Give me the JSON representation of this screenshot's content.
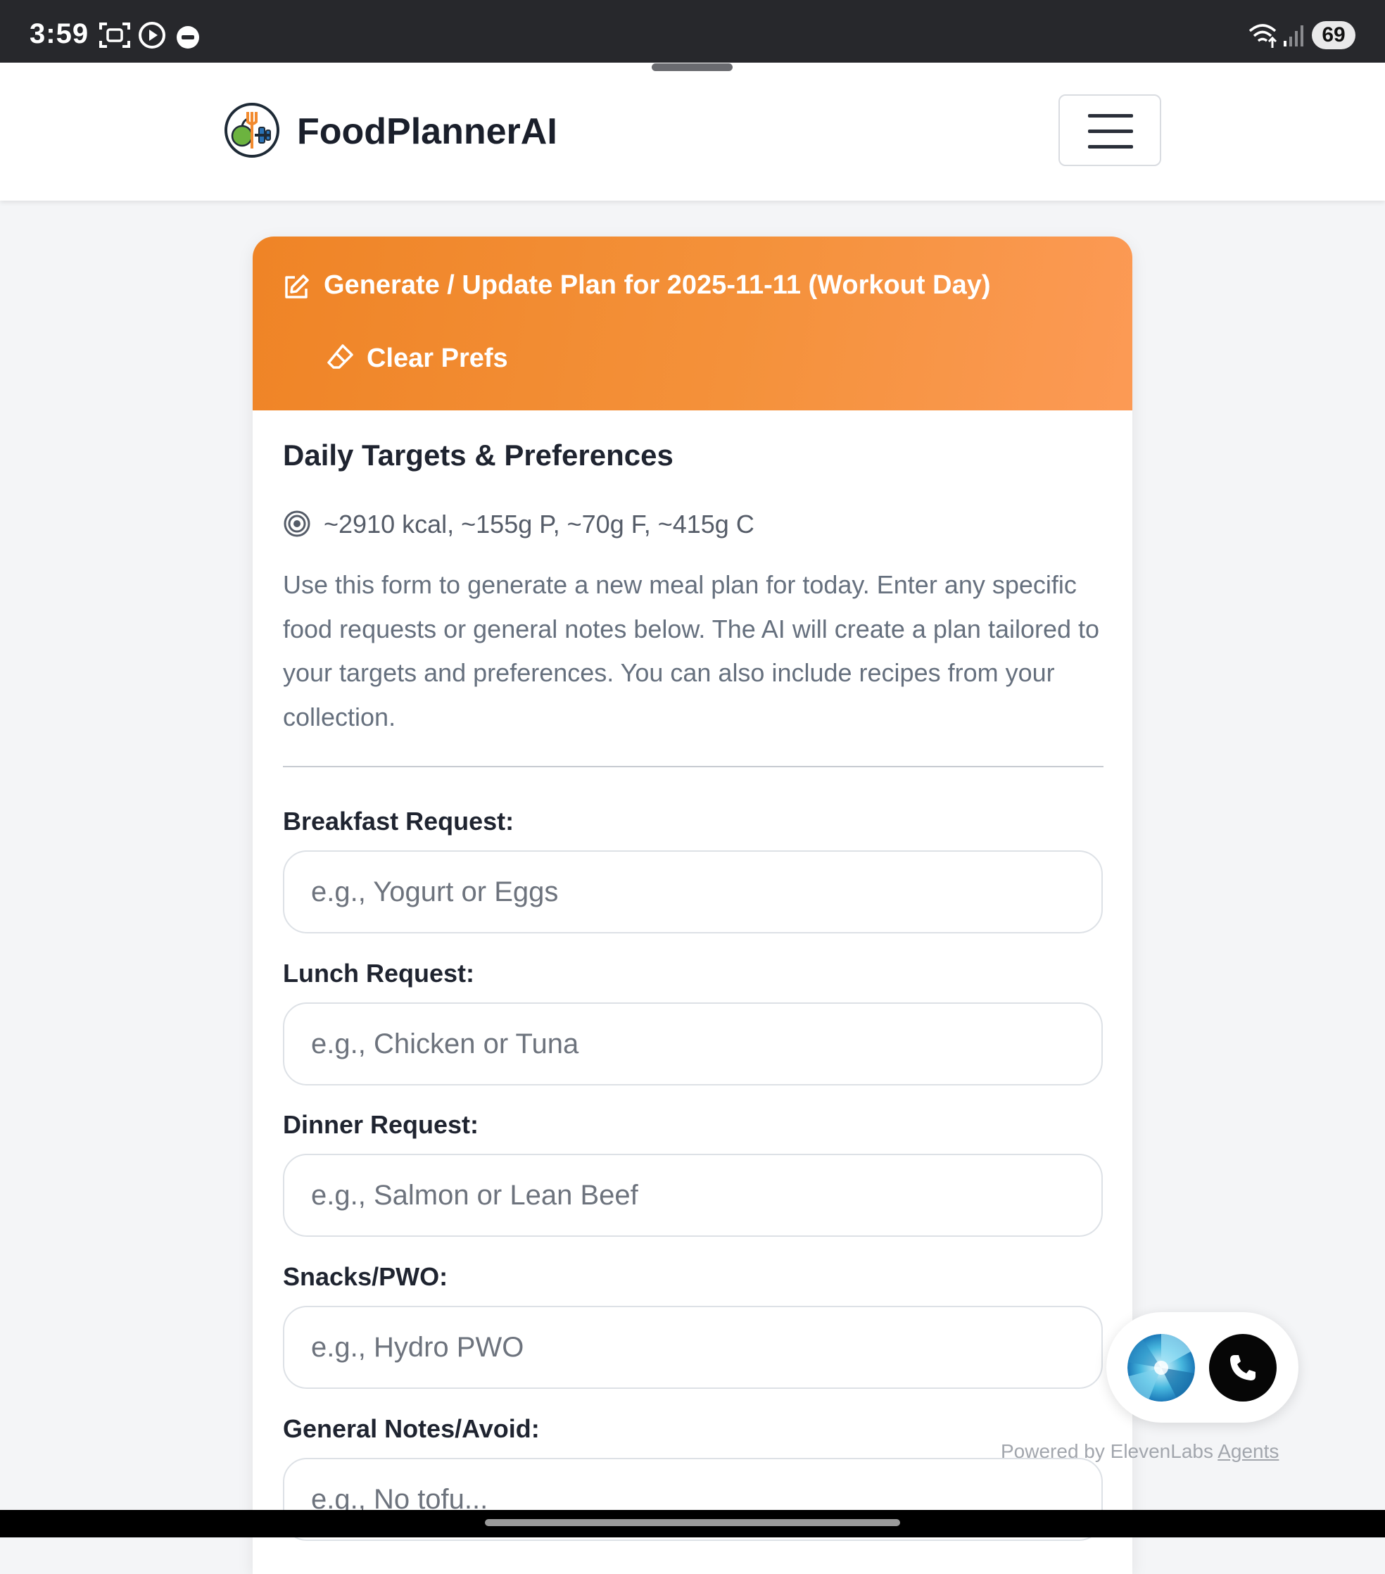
{
  "status_bar": {
    "time": "3:59",
    "battery": "69",
    "icons": [
      "screenshot-icon",
      "media-play-icon",
      "wear-icon",
      "wifi-icon",
      "signal-icon"
    ]
  },
  "header": {
    "brand": "FoodPlannerAI",
    "logo_icon": "apple-fork-dumbbell-logo",
    "menu_icon": "hamburger-icon"
  },
  "card": {
    "title": "Generate / Update Plan for 2025-11-11 (Workout Day)",
    "clear_label": "Clear Prefs",
    "section_title": "Daily Targets & Preferences",
    "targets": "~2910 kcal, ~155g P, ~70g F, ~415g C",
    "description": "Use this form to generate a new meal plan for today. Enter any specific food requests or general notes below. The AI will create a plan tailored to your targets and preferences. You can also include recipes from your collection.",
    "fields": [
      {
        "label": "Breakfast Request:",
        "placeholder": "e.g., Yogurt or Eggs"
      },
      {
        "label": "Lunch Request:",
        "placeholder": "e.g., Chicken or Tuna"
      },
      {
        "label": "Dinner Request:",
        "placeholder": "e.g., Salmon or Lean Beef"
      },
      {
        "label": "Snacks/PWO:",
        "placeholder": "e.g., Hydro PWO"
      },
      {
        "label": "General Notes/Avoid:",
        "placeholder": "e.g., No tofu..."
      }
    ]
  },
  "voice_widget": {
    "powered_prefix": "Powered by ElevenLabs",
    "powered_link": "Agents"
  },
  "colors": {
    "accent_orange": "#f28a2e",
    "status_bar": "#27282c"
  }
}
